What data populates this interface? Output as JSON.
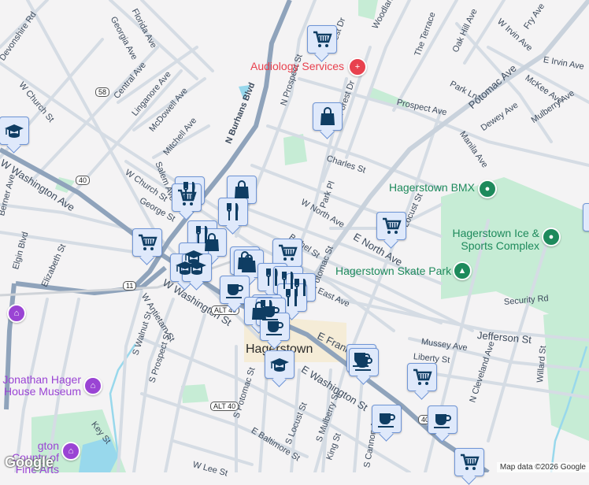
{
  "map": {
    "city_label": "Hagerstown",
    "attribution": "Map data ©2026 Google",
    "logo": "Google",
    "streets": [
      "Devonshire Rd",
      "Georgia Ave",
      "Florida Ave",
      "W Church St",
      "Central Ave",
      "Linganore Ave",
      "McDowell Ave",
      "Mitchell Ave",
      "N Burhans Blvd",
      "Salem Ave",
      "W Church St",
      "George St",
      "W Washington Ave",
      "Berner Ave",
      "Elgin Blvd",
      "Elizabeth St",
      "W Antietam St",
      "S Walnut St",
      "S Prospect St",
      "W Washington St",
      "S Potomac St",
      "E Baltimore St",
      "W Lee St",
      "Key St",
      "N Prospect St",
      "Forest Dr",
      "Woodland Way",
      "The Terrace",
      "Oak Hill Ave",
      "W Irvin Ave",
      "Fry Ave",
      "E Irvin Ave",
      "Potomac Ave",
      "Park Ln",
      "McKee Ave",
      "Prospect Ave",
      "Dewey Ave",
      "Mulberry Ave",
      "Manila Ave",
      "Charles St",
      "Park Pl",
      "W North Ave",
      "E North Ave",
      "N Locust St",
      "Bethel St",
      "N Potomac St",
      "East Ave",
      "E Franklin St",
      "E Washington St",
      "Jefferson St",
      "Mussey Ave",
      "Liberty St",
      "N Cleveland Ave",
      "Willard St",
      "Security Rd",
      "S Locust St",
      "S Mulberry St",
      "King St",
      "S Cannon Ave",
      "Forest Dr"
    ],
    "route_shields": [
      "58",
      "40",
      "11",
      "ALT 40",
      "ALT 40",
      "40"
    ],
    "places": [
      {
        "name": "Audiology Services",
        "category": "health",
        "color": "#e8414e"
      },
      {
        "name": "Hagerstown BMX",
        "category": "park",
        "color": "#1e8a5c"
      },
      {
        "name": "Hagerstown Ice & Sports Complex",
        "category": "park",
        "color": "#1e8a5c"
      },
      {
        "name": "Hagerstown Skate Park",
        "category": "park",
        "color": "#1e8a5c"
      },
      {
        "name": "Jonathan Hager House Museum",
        "category": "museum",
        "color": "#9a44d4"
      },
      {
        "name": "Washington County Museum of Fine Arts",
        "visible_text": "gton County of Fine Arts",
        "category": "museum",
        "color": "#9a44d4"
      }
    ],
    "marker_types": [
      "grocery-cart",
      "shopping-bag",
      "restaurant",
      "coffee",
      "education"
    ],
    "colors": {
      "marker_fill": "#dfe9fb",
      "marker_border": "#6f95d6",
      "icon": "#0f3d63",
      "highway": "#8fa3bb",
      "road": "#d5dce4",
      "park": "#c6ecd5",
      "water": "#98d8ec"
    }
  }
}
